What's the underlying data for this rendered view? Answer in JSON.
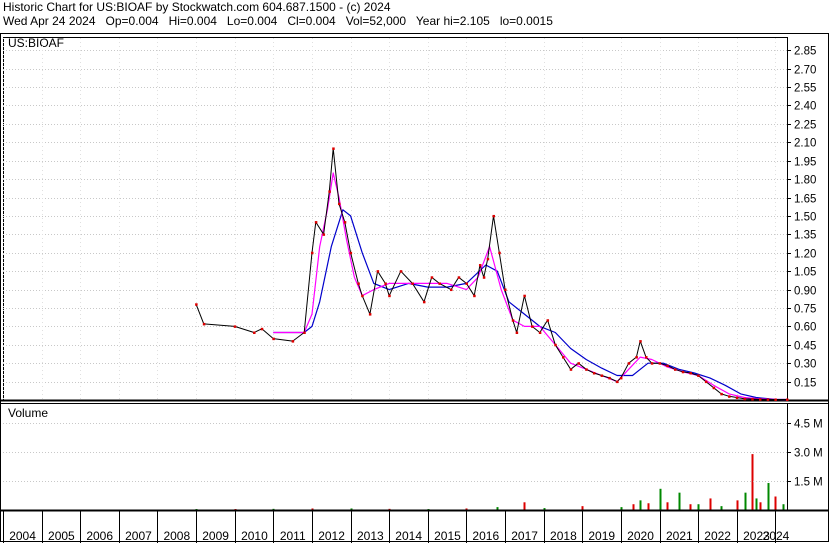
{
  "header": {
    "line1": "Historic Chart for US:BIOAF by Stockwatch.com 604.687.1500 - (c) 2024",
    "line2": "Wed Apr 24 2024   Op=0.004   Hi=0.004   Lo=0.004   Cl=0.004   Vol=52,000   Year hi=2.105   lo=0.0015"
  },
  "colors": {
    "price": "#000000",
    "dots": "#dd0000",
    "ma_fast": "#ff00ff",
    "ma_slow": "#0000cc",
    "vol_up": "#008800",
    "vol_down": "#dd0000"
  },
  "chart_data": [
    {
      "type": "line",
      "title": "US:BIOAF",
      "ylim": [
        0,
        2.95
      ],
      "yticks": [
        "2.85",
        "2.70",
        "2.55",
        "2.40",
        "2.25",
        "2.10",
        "1.95",
        "1.80",
        "1.65",
        "1.50",
        "1.35",
        "1.20",
        "1.05",
        "0.90",
        "0.75",
        "0.60",
        "0.45",
        "0.30",
        "0.15"
      ],
      "xticks": [
        "2004",
        "2005",
        "2006",
        "2007",
        "2008",
        "2009",
        "2010",
        "2011",
        "2012",
        "2013",
        "2014",
        "2015",
        "2016",
        "2017",
        "2018",
        "2019",
        "2020",
        "2021",
        "2022",
        "2023",
        "2024"
      ],
      "grid": true,
      "series": [
        {
          "key": "price",
          "x": [
            2009.0,
            2009.2,
            2010.0,
            2010.5,
            2010.7,
            2011.0,
            2011.5,
            2011.8,
            2012.0,
            2012.1,
            2012.3,
            2012.45,
            2012.55,
            2012.7,
            2012.85,
            2013.0,
            2013.2,
            2013.3,
            2013.5,
            2013.7,
            2013.9,
            2014.0,
            2014.3,
            2014.6,
            2014.9,
            2015.1,
            2015.3,
            2015.6,
            2015.8,
            2016.0,
            2016.2,
            2016.35,
            2016.45,
            2016.55,
            2016.7,
            2016.85,
            2017.0,
            2017.2,
            2017.3,
            2017.5,
            2017.7,
            2017.9,
            2018.1,
            2018.3,
            2018.5,
            2018.7,
            2018.9,
            2019.1,
            2019.3,
            2019.5,
            2019.7,
            2019.9,
            2020.0,
            2020.2,
            2020.4,
            2020.5,
            2020.65,
            2020.8,
            2021.0,
            2021.2,
            2021.4,
            2021.6,
            2021.8,
            2022.0,
            2022.2,
            2022.4,
            2022.6,
            2022.8,
            2023.0,
            2023.2,
            2023.4,
            2023.6,
            2023.8,
            2024.0,
            2024.3
          ],
          "values": [
            0.78,
            0.62,
            0.6,
            0.55,
            0.58,
            0.5,
            0.48,
            0.55,
            1.2,
            1.45,
            1.35,
            1.7,
            2.05,
            1.6,
            1.45,
            1.2,
            0.95,
            0.85,
            0.7,
            1.05,
            0.95,
            0.85,
            1.05,
            0.95,
            0.8,
            1.0,
            0.95,
            0.9,
            1.0,
            0.95,
            0.85,
            1.1,
            1.0,
            1.15,
            1.5,
            1.2,
            0.9,
            0.65,
            0.55,
            0.85,
            0.6,
            0.55,
            0.65,
            0.45,
            0.35,
            0.25,
            0.3,
            0.25,
            0.22,
            0.2,
            0.18,
            0.15,
            0.18,
            0.3,
            0.35,
            0.48,
            0.35,
            0.3,
            0.3,
            0.28,
            0.25,
            0.23,
            0.22,
            0.2,
            0.15,
            0.1,
            0.05,
            0.03,
            0.02,
            0.01,
            0.008,
            0.006,
            0.005,
            0.004,
            0.004
          ]
        },
        {
          "key": "ma_fast",
          "x": [
            2011.0,
            2011.8,
            2012.0,
            2012.2,
            2012.4,
            2012.55,
            2012.7,
            2012.9,
            2013.1,
            2013.3,
            2013.6,
            2014.0,
            2014.5,
            2015.0,
            2015.5,
            2016.0,
            2016.3,
            2016.6,
            2016.9,
            2017.2,
            2017.5,
            2017.9,
            2018.3,
            2018.7,
            2019.1,
            2019.5,
            2019.9,
            2020.2,
            2020.5,
            2020.8,
            2021.2,
            2021.6,
            2022.0,
            2022.4,
            2022.8,
            2023.2,
            2023.6,
            2024.0,
            2024.3
          ],
          "values": [
            0.55,
            0.55,
            0.7,
            1.25,
            1.55,
            1.85,
            1.65,
            1.3,
            1.0,
            0.85,
            0.9,
            0.95,
            0.95,
            0.95,
            0.95,
            0.9,
            1.0,
            1.25,
            0.9,
            0.65,
            0.6,
            0.6,
            0.45,
            0.3,
            0.25,
            0.2,
            0.15,
            0.25,
            0.35,
            0.33,
            0.27,
            0.23,
            0.2,
            0.12,
            0.05,
            0.02,
            0.01,
            0.005,
            0.004
          ]
        },
        {
          "key": "ma_slow",
          "x": [
            2011.0,
            2011.8,
            2012.0,
            2012.2,
            2012.5,
            2012.8,
            2013.0,
            2013.3,
            2013.6,
            2014.0,
            2014.5,
            2015.0,
            2015.5,
            2016.0,
            2016.5,
            2016.8,
            2017.1,
            2017.5,
            2017.9,
            2018.3,
            2018.7,
            2019.1,
            2019.5,
            2019.9,
            2020.3,
            2020.7,
            2021.1,
            2021.5,
            2021.9,
            2022.3,
            2022.7,
            2023.1,
            2023.5,
            2024.0,
            2024.3
          ],
          "values": [
            0.55,
            0.55,
            0.6,
            0.8,
            1.25,
            1.55,
            1.5,
            1.2,
            0.95,
            0.9,
            0.95,
            0.92,
            0.92,
            0.95,
            1.1,
            1.05,
            0.8,
            0.7,
            0.6,
            0.55,
            0.42,
            0.33,
            0.26,
            0.2,
            0.2,
            0.3,
            0.3,
            0.25,
            0.22,
            0.18,
            0.12,
            0.05,
            0.02,
            0.005,
            0.004
          ]
        }
      ]
    },
    {
      "type": "bar",
      "title": "Volume",
      "ylim": [
        0,
        5.5
      ],
      "yticks": [
        "4.5 M",
        "3.0 M",
        "1.5 M"
      ],
      "series": [
        {
          "name": "Volume",
          "x": [
            2009.0,
            2010.0,
            2011.0,
            2012.0,
            2013.0,
            2014.0,
            2015.0,
            2016.0,
            2016.8,
            2017.5,
            2018.0,
            2019.0,
            2020.0,
            2020.3,
            2020.5,
            2020.7,
            2021.0,
            2021.2,
            2021.5,
            2021.8,
            2022.0,
            2022.3,
            2022.6,
            2023.0,
            2023.2,
            2023.4,
            2023.5,
            2023.6,
            2023.8,
            2024.0,
            2024.2
          ],
          "values": [
            0.05,
            0.05,
            0.06,
            0.08,
            0.08,
            0.06,
            0.05,
            0.08,
            0.15,
            0.4,
            0.1,
            0.2,
            0.15,
            0.3,
            0.5,
            0.35,
            1.1,
            0.4,
            0.9,
            0.3,
            0.3,
            0.6,
            0.2,
            0.5,
            0.9,
            2.9,
            0.6,
            0.4,
            1.4,
            0.7,
            0.3
          ]
        }
      ]
    }
  ]
}
